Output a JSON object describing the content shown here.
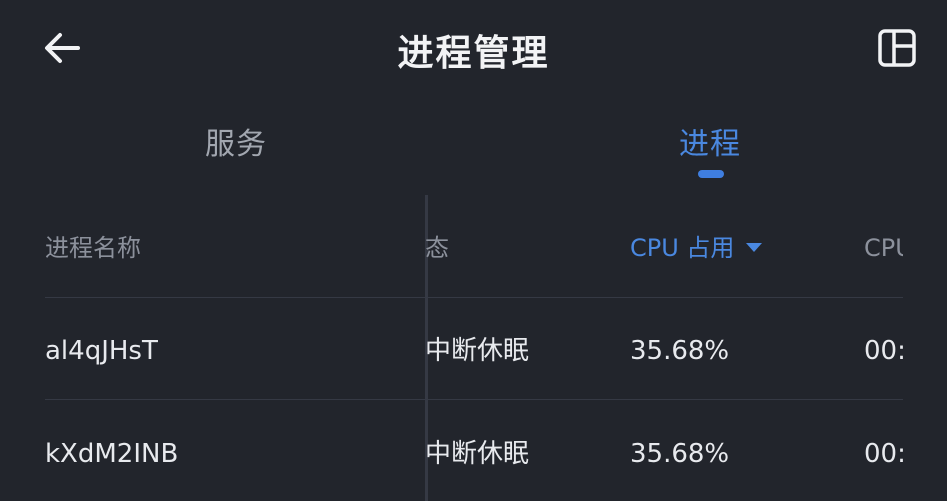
{
  "header": {
    "title": "进程管理",
    "back_icon": "arrow-left-icon",
    "layout_icon": "layout-panel-icon"
  },
  "tabs": [
    {
      "label": "服务",
      "active": false
    },
    {
      "label": "进程",
      "active": true
    }
  ],
  "table": {
    "columns": {
      "name": "进程名称",
      "state": "态",
      "cpu_usage": "CPU 占用",
      "cpu_time": "CPU"
    },
    "sort": {
      "column": "cpu_usage",
      "direction": "desc"
    },
    "rows": [
      {
        "name": "al4qJHsT",
        "state": "中断休眠",
        "cpu_usage": "35.68%",
        "cpu_time": "00:"
      },
      {
        "name": "kXdM2INB",
        "state": "中断休眠",
        "cpu_usage": "35.68%",
        "cpu_time": "00:"
      }
    ]
  },
  "colors": {
    "background": "#22252c",
    "accent": "#4a88e0",
    "text_primary": "#e8eaee",
    "text_secondary": "#8c919c",
    "divider": "#353944"
  }
}
